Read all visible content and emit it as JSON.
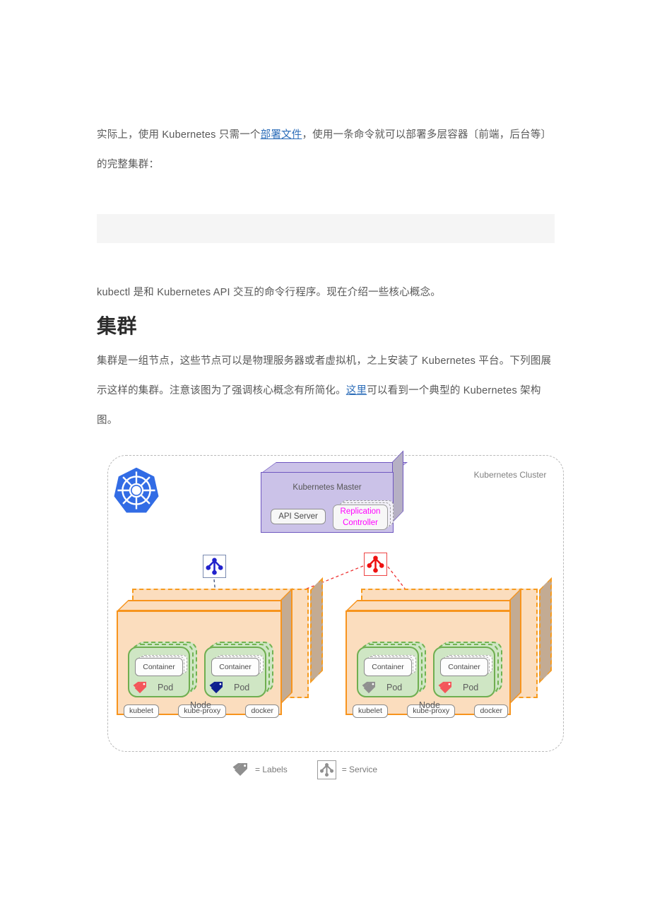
{
  "article": {
    "paragraph1_prefix": "实际上，使用 Kubernetes 只需一个",
    "paragraph1_link": "部署文件",
    "paragraph1_suffix": "，使用一条命令就可以部署多层容器〔前端，后台等〕的完整集群：",
    "codeblock_content": "",
    "paragraph2": "kubectl 是和 Kubernetes API 交互的命令行程序。现在介绍一些核心概念。",
    "heading": "集群",
    "paragraph3_prefix": "集群是一组节点，这些节点可以是物理服务器或者虚拟机，之上安装了 Kubernetes 平台。下列图展示这样的集群。注意该图为了强调核心概念有所简化。",
    "paragraph3_link": "这里",
    "paragraph3_suffix": "可以看到一个典型的 Kubernetes 架构图。"
  },
  "diagram": {
    "cluster_label": "Kubernetes Cluster",
    "logo_name": "kubernetes-logo",
    "master": {
      "title": "Kubernetes Master",
      "api_server": "API Server",
      "replication_controller_line1": "Replication",
      "replication_controller_line2": "Controller",
      "fill_color": "#cbc2e8",
      "border_color": "#6f57c0",
      "rc_text_color": "#ff00ff"
    },
    "services": [
      {
        "name": "service-blue",
        "color": "#2222cc"
      },
      {
        "name": "service-red",
        "color": "#ee1111"
      }
    ],
    "nodes": [
      {
        "label": "Node",
        "pods": [
          {
            "label": "Pod",
            "container": "Container",
            "tag_color": "#f4565a"
          },
          {
            "label": "Pod",
            "container": "Container",
            "tag_color": "#0d1f8f"
          }
        ],
        "daemons": [
          "kubelet",
          "kube-proxy",
          "docker"
        ]
      },
      {
        "label": "Node",
        "pods": [
          {
            "label": "Pod",
            "container": "Container",
            "tag_color": "#8f8f8f"
          },
          {
            "label": "Pod",
            "container": "Container",
            "tag_color": "#f4565a"
          }
        ],
        "daemons": [
          "kubelet",
          "kube-proxy",
          "docker"
        ]
      }
    ],
    "legend": {
      "labels_text": "= Labels",
      "service_text": "= Service",
      "labels_tag_color": "#8f8f8f"
    },
    "colors": {
      "node_fill": "#fbddbe",
      "node_border": "#f7941d",
      "pod_fill": "#cfe6c4",
      "pod_border": "#6fae50",
      "cluster_border": "#b9b9b9"
    }
  }
}
